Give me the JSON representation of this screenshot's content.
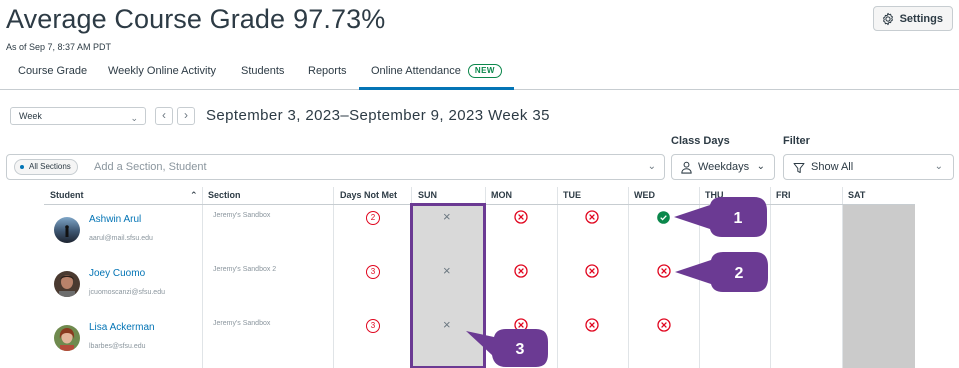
{
  "header": {
    "title": "Average Course Grade",
    "grade": "97.73%",
    "as_of": "As of Sep 7, 8:37 AM PDT",
    "settings_label": "Settings"
  },
  "tabs": [
    {
      "label": "Course Grade"
    },
    {
      "label": "Weekly Online Activity"
    },
    {
      "label": "Students"
    },
    {
      "label": "Reports"
    },
    {
      "label": "Online Attendance",
      "badge": "NEW",
      "active": true
    }
  ],
  "week_nav": {
    "period_select": "Week",
    "prev_icon": "chevron-left-icon",
    "next_icon": "chevron-right-icon",
    "week_title": "September 3, 2023–September 9, 2023 Week 35"
  },
  "filters": {
    "class_days_label": "Class Days",
    "filter_label": "Filter",
    "section_chip": "All Sections",
    "search_placeholder": "Add a Section, Student",
    "class_days_value": "Weekdays",
    "filter_value": "Show All"
  },
  "table": {
    "headers": [
      "Student",
      "Section",
      "Days Not Met",
      "SUN",
      "MON",
      "TUE",
      "WED",
      "THU",
      "FRI",
      "SAT"
    ],
    "rows": [
      {
        "name": "Ashwin Arul",
        "email": "aarul@mail.sfsu.edu",
        "section": "Jeremy's Sandbox",
        "days_not_met": "2",
        "sun": "not-applicable",
        "mon": "missed",
        "tue": "missed",
        "wed": "present"
      },
      {
        "name": "Joey Cuomo",
        "email": "jcuomoscanzi@sfsu.edu",
        "section": "Jeremy's Sandbox 2",
        "days_not_met": "3",
        "sun": "not-applicable",
        "mon": "missed",
        "tue": "missed",
        "wed": "missed"
      },
      {
        "name": "Lisa Ackerman",
        "email": "lbarbes@sfsu.edu",
        "section": "Jeremy's Sandbox",
        "days_not_met": "3",
        "sun": "not-applicable",
        "mon": "missed",
        "tue": "missed",
        "wed": "missed"
      }
    ]
  },
  "callouts": [
    "1",
    "2",
    "3"
  ],
  "colors": {
    "accent": "#0374b5",
    "missed": "#e0061f",
    "present": "#0b874b",
    "callout": "#6b3a93",
    "new_badge": "#0b874b"
  }
}
